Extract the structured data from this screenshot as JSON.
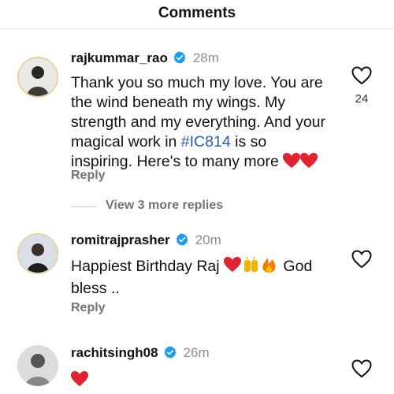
{
  "header": {
    "title": "Comments"
  },
  "comments": [
    {
      "username": "rajkummar_rao",
      "time": "28m",
      "text_parts": [
        "Thank you so much my love. You are the wind beneath my wings. My strength and my everything. And your magical work in ",
        "#IC814",
        " is so inspiring. Here's to many more"
      ],
      "reply_label": "Reply",
      "likes": "24"
    },
    {
      "username": "romitrajprasher",
      "time": "20m",
      "text_parts": [
        "Happiest Birthday Raj",
        " God bless .."
      ],
      "reply_label": "Reply"
    },
    {
      "username": "rachitsingh08",
      "time": "26m"
    }
  ],
  "view_more": {
    "label": "View 3 more replies"
  },
  "icons": {
    "heart": "heart-icon",
    "verified": "verified-badge-icon"
  },
  "colors": {
    "verified": "#1d9bf0",
    "hashtag": "#2f5da8",
    "muted": "#8e8e8e",
    "emoji_heart": "#e0232e"
  }
}
